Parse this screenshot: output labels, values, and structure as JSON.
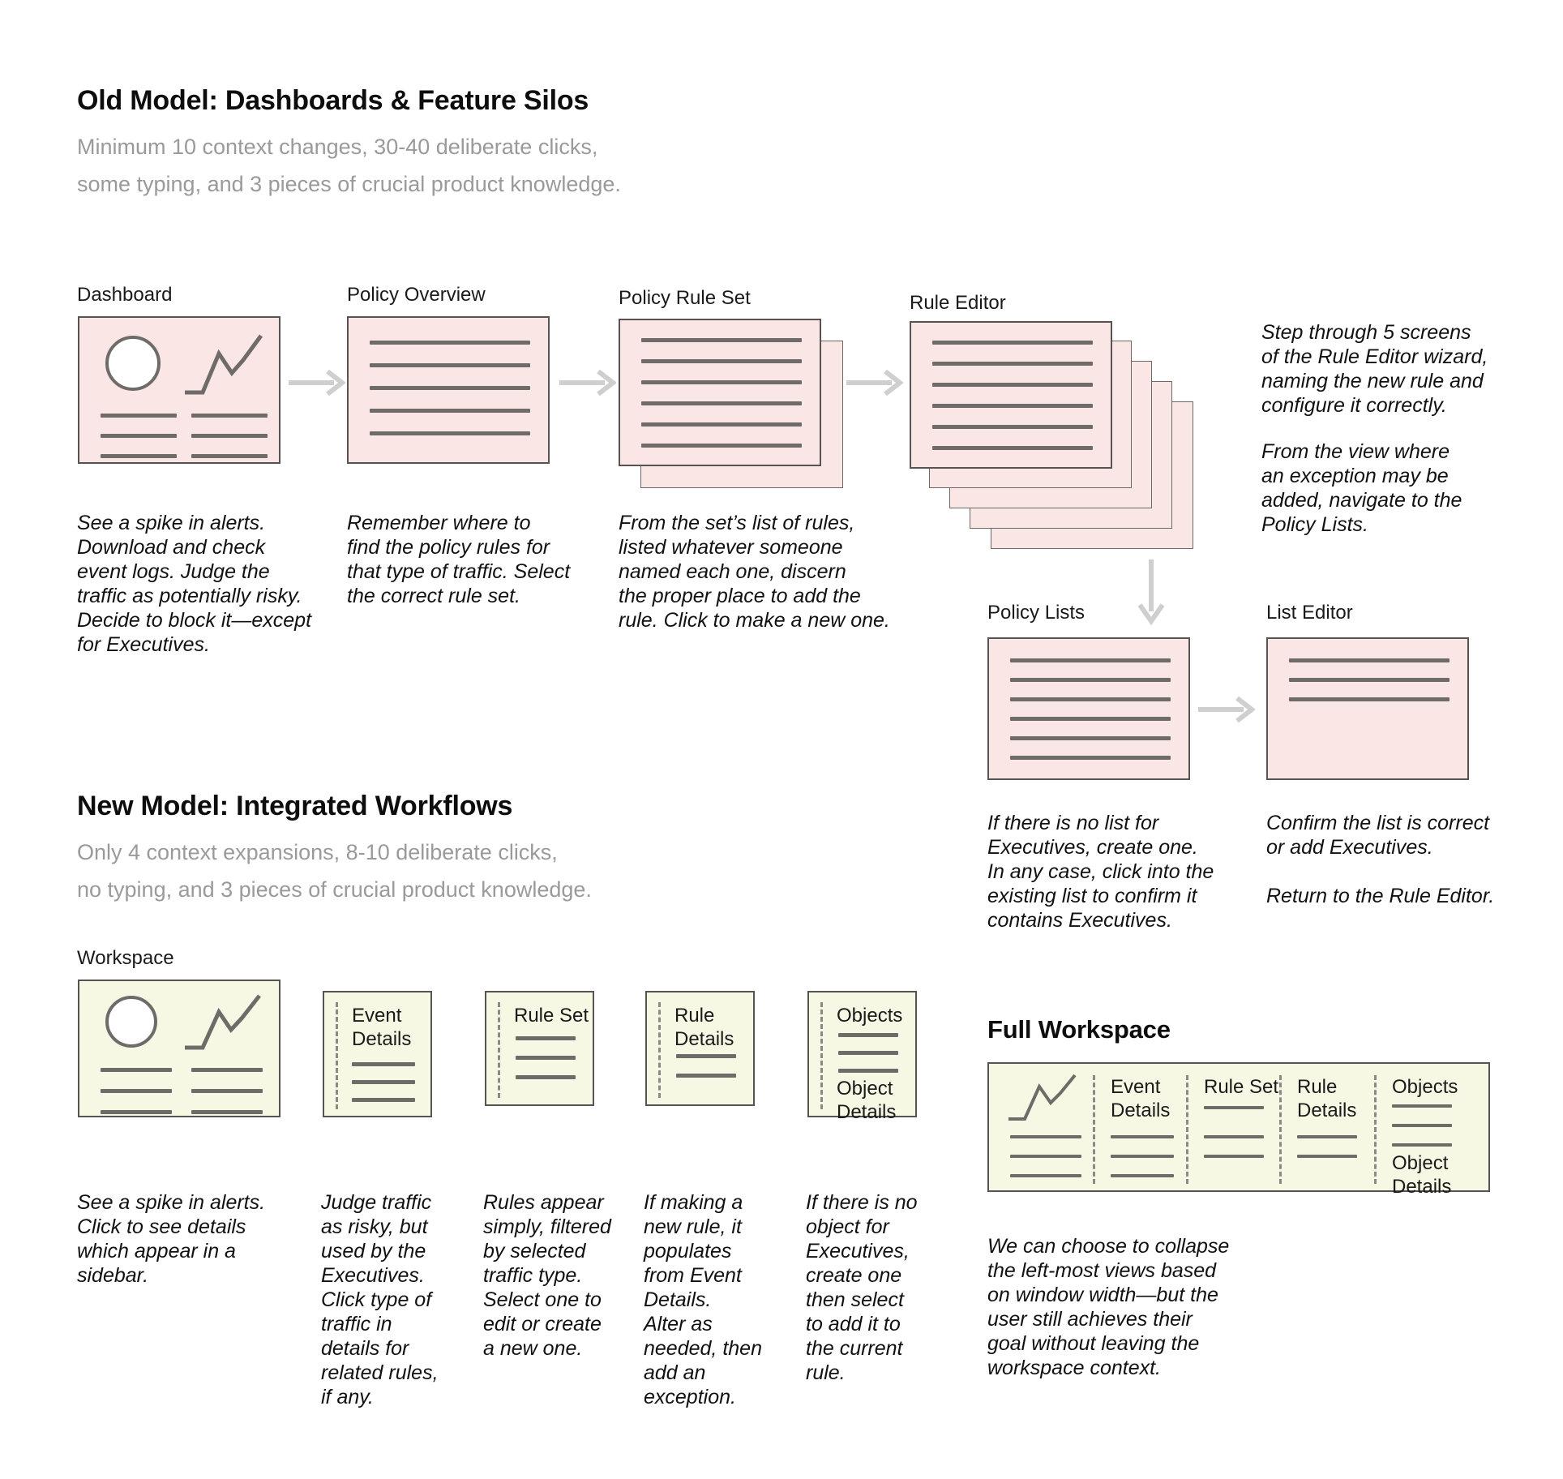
{
  "old_model": {
    "title": "Old Model: Dashboards & Feature Silos",
    "subtitle": "Minimum 10 context changes, 30-40 deliberate clicks,\nsome typing, and 3 pieces of crucial product knowledge.",
    "screens": [
      {
        "label": "Dashboard",
        "caption": "See a spike in alerts.\nDownload and check\nevent logs. Judge the\ntraffic as potentially risky.\nDecide to block it—except\nfor Executives."
      },
      {
        "label": "Policy Overview",
        "caption": "Remember where to\nfind the policy rules for\nthat type of traffic. Select\nthe correct rule set."
      },
      {
        "label": "Policy Rule Set",
        "caption": "From the set’s list of rules,\nlisted whatever someone\nnamed each one, discern\nthe proper place to add the\nrule. Click to make a new one."
      },
      {
        "label": "Rule Editor",
        "caption": ""
      },
      {
        "label": "Policy Lists",
        "caption": "If there is no list for\nExecutives, create one.\nIn any case, click into the\nexisting list to confirm it\ncontains Executives."
      },
      {
        "label": "List Editor",
        "caption": "Confirm the list is correct\nor add Executives.\n\nReturn to the Rule Editor."
      }
    ],
    "rule_editor_note_1": "Step through 5 screens\nof the Rule Editor wizard,\nnaming the new rule and\nconfigure it correctly.",
    "rule_editor_note_2": "From the view where\nan exception may be\nadded, navigate to the\nPolicy Lists."
  },
  "new_model": {
    "title": "New Model: Integrated Workflows",
    "subtitle": "Only 4 context expansions, 8-10 deliberate clicks,\nno typing, and 3 pieces of crucial product knowledge.",
    "workspace_label": "Workspace",
    "full_workspace_label": "Full Workspace",
    "panels": [
      {
        "title": "",
        "caption": "See a spike in alerts.\nClick to see details\nwhich appear in a\nsidebar."
      },
      {
        "title": "Event\nDetails",
        "caption": "Judge traffic\nas risky, but\nused by the\nExecutives.\nClick type of\ntraffic in\ndetails for\nrelated rules,\nif any."
      },
      {
        "title": "Rule Set",
        "caption": "Rules appear\nsimply, filtered\nby selected\ntraffic type.\nSelect one to\nedit or create\na new one."
      },
      {
        "title": "Rule\nDetails",
        "caption": "If making a\nnew rule, it\npopulates\nfrom Event\nDetails.\nAlter as\nneeded, then\nadd an\nexception."
      },
      {
        "title": "Objects",
        "caption": "If there is no\nobject for\nExecutives,\ncreate one\nthen select\nto add it to\nthe current\nrule."
      }
    ],
    "objects_subtitle": "Object\nDetails",
    "full_workspace_columns": [
      "Event\nDetails",
      "Rule Set",
      "Rule\nDetails",
      "Objects"
    ],
    "full_workspace_object_details": "Object\nDetails",
    "full_workspace_caption": "We can choose to collapse\nthe left-most views based\non window width—but the\nuser still achieves their\ngoal without leaving the\nworkspace context."
  },
  "colors": {
    "old_fill": "#fbe6e6",
    "new_fill": "#f7f8e4",
    "stroke": "#565350",
    "rule_line": "#6e6b68",
    "arrow": "#cfcfcf",
    "muted_text": "#9a9a9a"
  }
}
